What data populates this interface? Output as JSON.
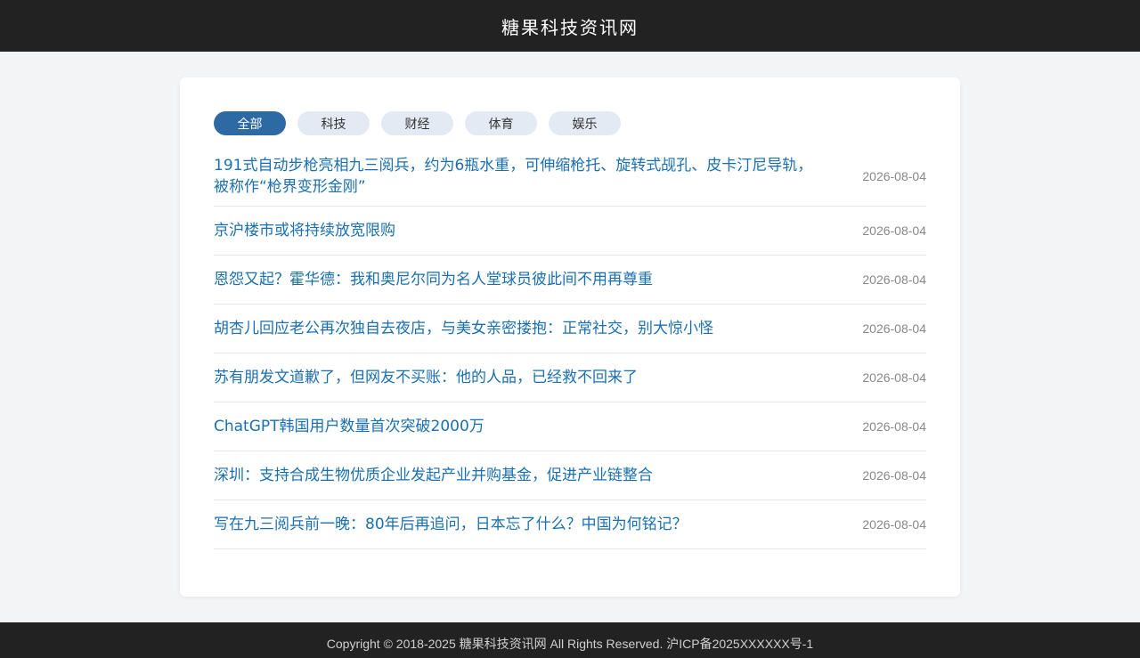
{
  "header": {
    "site_title": "糖果科技资讯网"
  },
  "tabs": [
    {
      "label": "全部",
      "active": true
    },
    {
      "label": "科技",
      "active": false
    },
    {
      "label": "财经",
      "active": false
    },
    {
      "label": "体育",
      "active": false
    },
    {
      "label": "娱乐",
      "active": false
    }
  ],
  "news": [
    {
      "title": "191式自动步枪亮相九三阅兵，约为6瓶水重，可伸缩枪托、旋转式觇孔、皮卡汀尼导轨，被称作“枪界变形金刚”",
      "date": "2026-08-04"
    },
    {
      "title": "京沪楼市或将持续放宽限购",
      "date": "2026-08-04"
    },
    {
      "title": "恩怨又起？霍华德：我和奥尼尔同为名人堂球员彼此间不用再尊重",
      "date": "2026-08-04"
    },
    {
      "title": "胡杏儿回应老公再次独自去夜店，与美女亲密搂抱：正常社交，别大惊小怪",
      "date": "2026-08-04"
    },
    {
      "title": "苏有朋发文道歉了，但网友不买账：他的人品，已经救不回来了",
      "date": "2026-08-04"
    },
    {
      "title": "ChatGPT韩国用户数量首次突破2000万",
      "date": "2026-08-04"
    },
    {
      "title": "深圳：支持合成生物优质企业发起产业并购基金，促进产业链整合",
      "date": "2026-08-04"
    },
    {
      "title": "写在九三阅兵前一晚：80年后再追问，日本忘了什么？中国为何铭记？",
      "date": "2026-08-04"
    }
  ],
  "footer": {
    "copyright": "Copyright © 2018-2025 糖果科技资讯网 All Rights Reserved. 沪ICP备2025XXXXXX号-1"
  }
}
